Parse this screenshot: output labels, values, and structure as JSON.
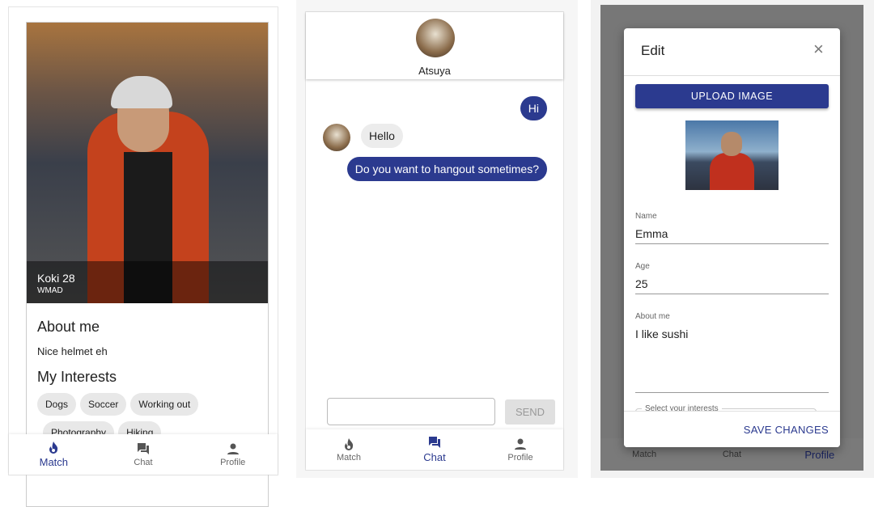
{
  "match": {
    "name_age": "Koki 28",
    "school": "WMAD",
    "about_heading": "About me",
    "about_text": "Nice helmet eh",
    "interests_heading": "My Interests",
    "interests": [
      "Dogs",
      "Soccer",
      "Working out",
      "Photography",
      "Hiking"
    ]
  },
  "chat": {
    "contact": "Atsuya",
    "messages": [
      {
        "from": "me",
        "text": "Hi"
      },
      {
        "from": "them",
        "text": "Hello"
      },
      {
        "from": "me",
        "text": "Do you want to hangout sometimes?"
      }
    ],
    "input_value": "",
    "send_label": "SEND"
  },
  "edit": {
    "title": "Edit",
    "upload_label": "UPLOAD IMAGE",
    "name_label": "Name",
    "name_value": "Emma",
    "age_label": "Age",
    "age_value": "25",
    "about_label": "About me",
    "about_value": "I like sushi",
    "interests_label": "Select your interests",
    "save_label": "SAVE CHANGES"
  },
  "nav": {
    "match": "Match",
    "chat": "Chat",
    "profile": "Profile"
  },
  "colors": {
    "accent": "#2b3a8f",
    "chip": "#e8e8e8",
    "overlay": "#777777"
  }
}
